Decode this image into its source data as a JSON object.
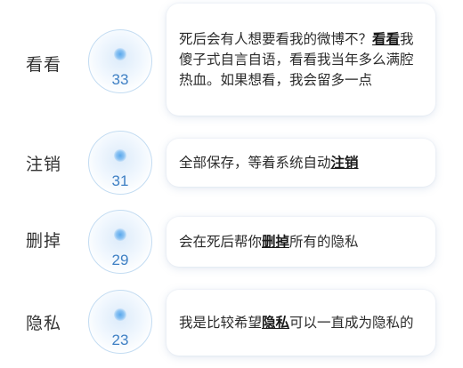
{
  "entries": [
    {
      "label": "看看",
      "count": "33",
      "before": "死后会有人想要看我的微博不？",
      "keyword": "看看",
      "after": "我傻子式自言自语，看看我当年多么满腔热血。如果想看，我会留多一点"
    },
    {
      "label": "注销",
      "count": "31",
      "before": "全部保存，等着系统自动",
      "keyword": "注销",
      "after": ""
    },
    {
      "label": "删掉",
      "count": "29",
      "before": "会在死后帮你",
      "keyword": "删掉",
      "after": "所有的隐私"
    },
    {
      "label": "隐私",
      "count": "23",
      "before": "我是比较希望",
      "keyword": "隐私",
      "after": "可以一直成为隐私的"
    }
  ]
}
